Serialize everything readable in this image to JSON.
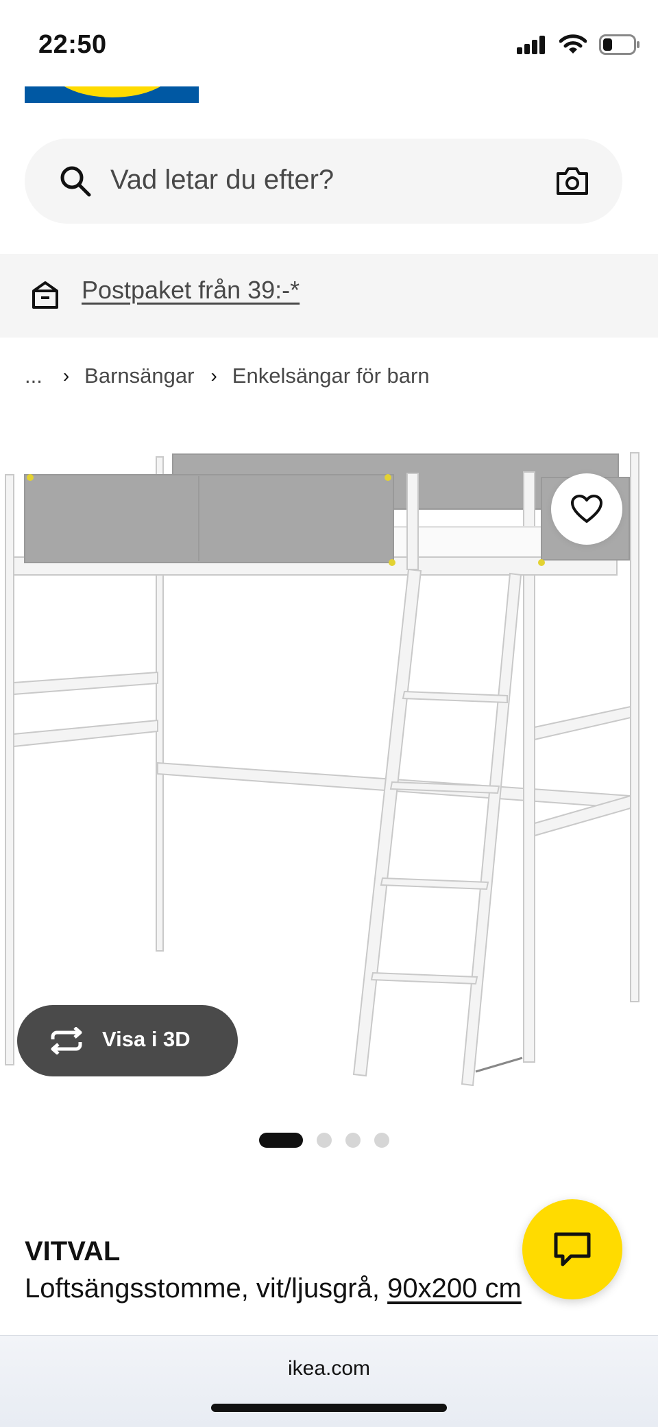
{
  "status_bar": {
    "time": "22:50"
  },
  "search": {
    "placeholder": "Vad letar du efter?"
  },
  "promo": {
    "text": "Postpaket från 39:-*"
  },
  "breadcrumb": {
    "ellipsis": "...",
    "items": [
      "Barnsängar",
      "Enkelsängar för barn"
    ]
  },
  "gallery": {
    "view3d_label": "Visa i 3D",
    "page_count": 4,
    "active_page": 1
  },
  "product": {
    "name": "VITVAL",
    "description": "Loftsängsstomme, vit/ljusgrå, ",
    "size": "90x200 cm"
  },
  "browser": {
    "url": "ikea.com"
  },
  "colors": {
    "brand_blue": "#0058a3",
    "brand_yellow": "#ffdb00",
    "surface": "#f5f5f5",
    "dark_button": "#4a4a4a"
  },
  "icons": [
    "signal-icon",
    "wifi-icon",
    "battery-icon",
    "search-icon",
    "camera-icon",
    "parcel-icon",
    "chevron-right-icon",
    "heart-icon",
    "rotate-3d-icon",
    "chat-icon"
  ]
}
